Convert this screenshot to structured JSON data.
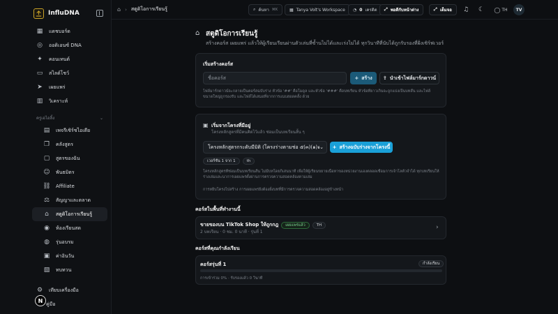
{
  "brand": {
    "name": "InfluDNA"
  },
  "sidebar": {
    "items": [
      {
        "label": "แดชบอร์ด",
        "icon": "grid-icon"
      },
      {
        "label": "ออดิเอนซ์ DNA",
        "icon": "dna-icon"
      },
      {
        "label": "คอนเทนต์",
        "icon": "sparkles-icon"
      },
      {
        "label": "สไลด์โชว์",
        "icon": "slides-icon"
      },
      {
        "label": "เผยแพร่",
        "icon": "send-icon"
      },
      {
        "label": "วิเคราะห์",
        "icon": "chart-icon"
      }
    ],
    "section_label": "ครูเอไอลิ้ง",
    "sub_items": [
      {
        "label": "เพจรีเซิร์ชไอเดีย",
        "icon": "table-icon"
      },
      {
        "label": "คลังสูตร",
        "icon": "book-icon"
      },
      {
        "label": "สูตรของฉัน",
        "icon": "file-icon"
      },
      {
        "label": "พันธมิตร",
        "icon": "users-icon"
      },
      {
        "label": "Affiliate",
        "icon": "link-icon"
      },
      {
        "label": "สัญญาและตลาด",
        "icon": "contract-icon"
      },
      {
        "label": "สตูดิโอการเรียนรู้",
        "icon": "graduation-icon",
        "active": true
      },
      {
        "label": "ห้องเรียนสด",
        "icon": "broadcast-icon"
      },
      {
        "label": "รุ่นอบรม",
        "icon": "cohort-icon"
      },
      {
        "label": "ค่าอินวัน",
        "icon": "calendar-icon"
      },
      {
        "label": "ทบทวน",
        "icon": "review-icon"
      },
      {
        "label": "เครดิตส์",
        "icon": "coin-icon"
      }
    ],
    "bottom": [
      {
        "label": "เทียบเครื่องมือ",
        "icon": "settings-icon"
      },
      {
        "label": "คู่มือ",
        "icon": "help-icon"
      }
    ],
    "avatar_letter": "N"
  },
  "topbar": {
    "breadcrumb": "สตูดิโอการเรียนรู้",
    "search_label": "ค้นหา",
    "search_kbd": "⌘K",
    "workspace": "Tanya Volt's Workspace",
    "credits_value": "0",
    "credits_label": "เครดิต",
    "upgrade_label": "พอดีกับหน้าต่าง",
    "fullscreen_label": "เต็มจอ",
    "lang": "TH",
    "user_initials": "TV"
  },
  "page": {
    "title": "สตูดิโอการเรียนรู้",
    "subtitle": "สร้างคอร์ส เผยแพร่ แล้วให้ผู้เรียนเรียนผ่านตัวเล่นที่ซ้ำนไม่ได้และเร่งไม่ได้ ทุกวินาทีที่นับได้ถูกรับรองที่ฝั่งเซิร์ฟเวอร์"
  },
  "create_card": {
    "title": "เริ่มสร้างคอร์ส",
    "input_placeholder": "ชื่อคอร์ส",
    "create_label": "สร้าง",
    "import_label": "นำเข้าไฟล์มาร์กดาวน์",
    "hint": "ไฟล์มาร์กดาวน์จะกลายเป็นคอร์สฉบับร่าง หัวข้อ '##' คือโมดูล และหัวข้อ '###' คือบทเรียน หัวข้อที่ยาวเกินจะถูกแบ่งเป็นบทสั้น และไฟล์ขนาดใหญ่ถูกรองรับ และไฟล์ได้เสมอที่จากการแนบสอดคลั้ง ด้วย"
  },
  "project_card": {
    "title": "เริ่มจากโครงที่มีอยู่",
    "subtitle": "โครงหลักสูตรที่มีคนคิดไว้แล้ว ซ่อมเป็นบทเรียนสั้น ๆ",
    "select_value": "โครงหลักสูตรกระดับมีมิติ (โครงร่างตามช่อ ๕(๓)(๑)๑)",
    "generate_label": "สร้างฉบับร่างจากโครงนี้",
    "tags": [
      "เวอร์ชัน 1 จาก 1",
      "th"
    ],
    "description": "โครงหลักสูตรที่ซ่อมเป็นบทเรียนสั้น ไม่มีบทโดยกิเสนนาที เพื่อให้ผู้เรียนขยายเนื้อหาของหน่วยงานเองตลอดเชื่อมการเจ้าโลตัวจำได้ ทุกบทเรียนให้ร่างเล่มและนาการเผยแพร่ตั้งผ่านการตรวจความสอดคล้องตามเล่ม",
    "footnote": "การหยิบโครงไปสร้าง การเผยแพร่ยังต้องฝั่งบทที่มีการตรวจความสอดคล้องอยู่ข้างหน้า"
  },
  "my_courses": {
    "heading": "คอร์สในพื้นที่ทำงานนี้",
    "course": {
      "title": "ขายของบน TikTok Shop ให้ถูกกฎ",
      "status": "เผยแพร่แล้ว",
      "lang": "TH",
      "meta": "2 บทเรียน · 0 ชม. 0 นาที · รุ่นที่ 1"
    }
  },
  "in_progress": {
    "heading": "คอร์สที่คุณกำลังเรียน",
    "course": {
      "title": "คอร์สรุ่นที่ 1",
      "status": "กำลังเรียน",
      "progress_pct": 0,
      "meta": "การเข้าร่วม 0% · รับรองแล้ว 0 วินาที"
    }
  }
}
